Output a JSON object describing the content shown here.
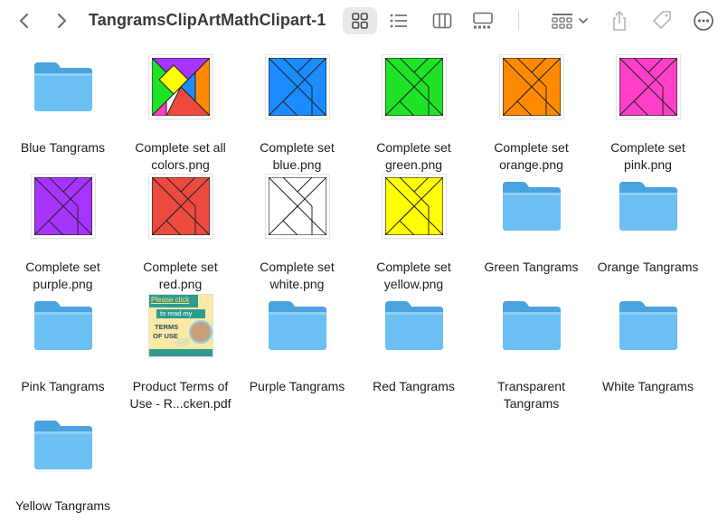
{
  "window": {
    "title": "TangramsClipArtMathClipart-1"
  },
  "toolbar": {
    "back_icon": "chevron-left-icon",
    "forward_icon": "chevron-right-icon",
    "view_modes": [
      {
        "icon": "icon-view-grid-icon",
        "active": true
      },
      {
        "icon": "list-view-icon",
        "active": false
      },
      {
        "icon": "column-view-icon",
        "active": false
      },
      {
        "icon": "gallery-view-icon",
        "active": false
      }
    ],
    "group_icon": "group-by-icon",
    "share_icon": "share-icon",
    "tag_icon": "tag-icon",
    "more_icon": "more-ellipsis-icon"
  },
  "colors": {
    "folder": "#5fb6ee",
    "blue": "#1a8cff",
    "green": "#1ee326",
    "orange": "#ff8a00",
    "pink": "#ff3fc7",
    "purple": "#a735ff",
    "red": "#ec4a3f",
    "white": "#ffffff",
    "yellow": "#ffff00"
  },
  "files": [
    {
      "name": "Blue Tangrams",
      "kind": "folder"
    },
    {
      "name": "Complete set all\ncolors.png",
      "kind": "multi"
    },
    {
      "name": "Complete set\nblue.png",
      "kind": "tangram",
      "color": "#1a8cff"
    },
    {
      "name": "Complete set\ngreen.png",
      "kind": "tangram",
      "color": "#1ee326"
    },
    {
      "name": "Complete set\norange.png",
      "kind": "tangram",
      "color": "#ff8a00"
    },
    {
      "name": "Complete set\npink.png",
      "kind": "tangram",
      "color": "#ff3fc7"
    },
    {
      "name": "Complete set\npurple.png",
      "kind": "tangram",
      "color": "#a735ff"
    },
    {
      "name": "Complete set\nred.png",
      "kind": "tangram",
      "color": "#ec4a3f"
    },
    {
      "name": "Complete set\nwhite.png",
      "kind": "tangram",
      "color": "#ffffff"
    },
    {
      "name": "Complete set\nyellow.png",
      "kind": "tangram",
      "color": "#ffff00"
    },
    {
      "name": "Green Tangrams",
      "kind": "folder"
    },
    {
      "name": "Orange Tangrams",
      "kind": "folder"
    },
    {
      "name": "Pink Tangrams",
      "kind": "folder"
    },
    {
      "name": "Product Terms of\nUse - R...cken.pdf",
      "kind": "pdf"
    },
    {
      "name": "Purple Tangrams",
      "kind": "folder"
    },
    {
      "name": "Red Tangrams",
      "kind": "folder"
    },
    {
      "name": "Transparent\nTangrams",
      "kind": "folder"
    },
    {
      "name": "White Tangrams",
      "kind": "folder"
    },
    {
      "name": "Yellow Tangrams",
      "kind": "folder"
    }
  ],
  "pdf_preview": {
    "line1": "Please click",
    "line2": "to read my",
    "line3": "TERMS",
    "line4": "OF USE",
    "badge": "PDF"
  }
}
